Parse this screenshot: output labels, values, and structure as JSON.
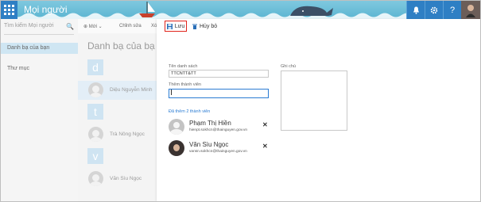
{
  "header": {
    "app_title": "Mọi người",
    "icons": [
      "bell-icon",
      "gear-icon",
      "help-icon"
    ]
  },
  "left": {
    "search_placeholder": "Tìm kiếm Mọi người",
    "nav": [
      {
        "label": "Danh bạ của bạn",
        "selected": true
      },
      {
        "label": "Thư mục",
        "selected": false
      }
    ]
  },
  "middle": {
    "toolbar": {
      "new_label": "Mới",
      "edit_label": "Chỉnh sửa",
      "more_label": "Xó"
    },
    "title": "Danh bạ của bạ",
    "groups": [
      {
        "letter": "d",
        "contact": "Diệu Nguyễn Minh"
      },
      {
        "letter": "t",
        "contact": "Trà Nông Ngọc"
      },
      {
        "letter": "v",
        "contact": "Văn Sìu Ngọc"
      }
    ]
  },
  "form": {
    "save_label": "Lưu",
    "cancel_label": "Hủy bỏ",
    "list_name_label": "Tên danh sách",
    "list_name_value": "TTCNTT&TT",
    "add_member_label": "Thêm thành viên",
    "add_member_value": "",
    "notes_label": "Ghi chú",
    "added_label": "Đã thêm 2 thành viên",
    "members": [
      {
        "name": "Phạm Thị Hiền",
        "email": "hienpt.sokhcn@thainguyen.gov.vn"
      },
      {
        "name": "Văn Sìu Ngọc",
        "email": "vansn.sokhcn@thainguyen.gov.vn"
      }
    ]
  },
  "colors": {
    "header_bg": "#5bb5d1",
    "header_icon_bg": "#2e7fc4",
    "save_highlight": "#e0241b",
    "accent": "#2b7cd3"
  }
}
